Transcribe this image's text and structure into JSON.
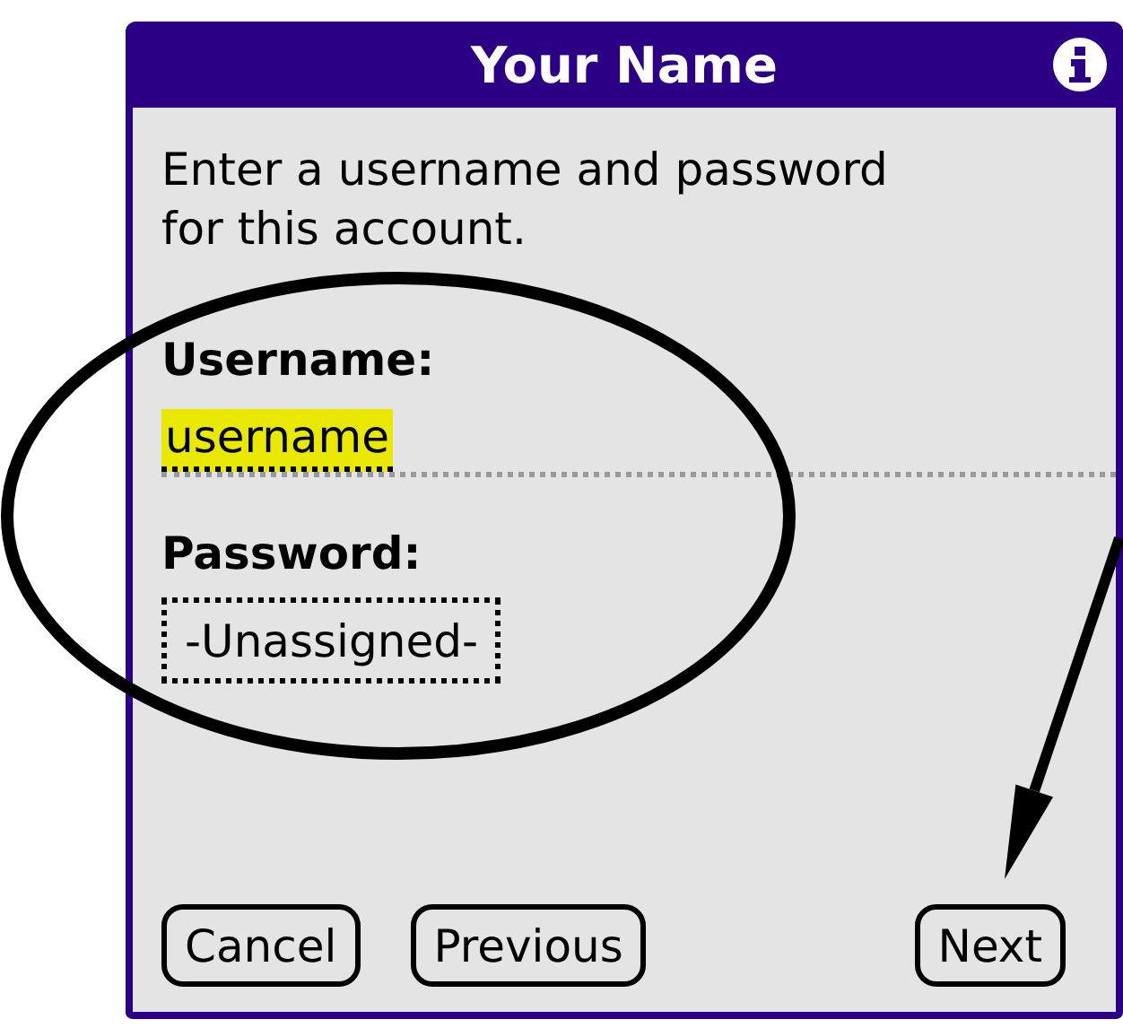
{
  "window": {
    "title": "Your Name"
  },
  "instructions": "Enter a username and password for this account.",
  "username": {
    "label": "Username:",
    "value": "username",
    "highlighted": true
  },
  "password": {
    "label": "Password:",
    "value": "-Unassigned-"
  },
  "left_buttons": [
    "Cancel",
    "Previous"
  ],
  "right_buttons": [
    "Next"
  ],
  "annotations": [
    {
      "kind": "ellipse"
    },
    {
      "kind": "arrow"
    }
  ]
}
